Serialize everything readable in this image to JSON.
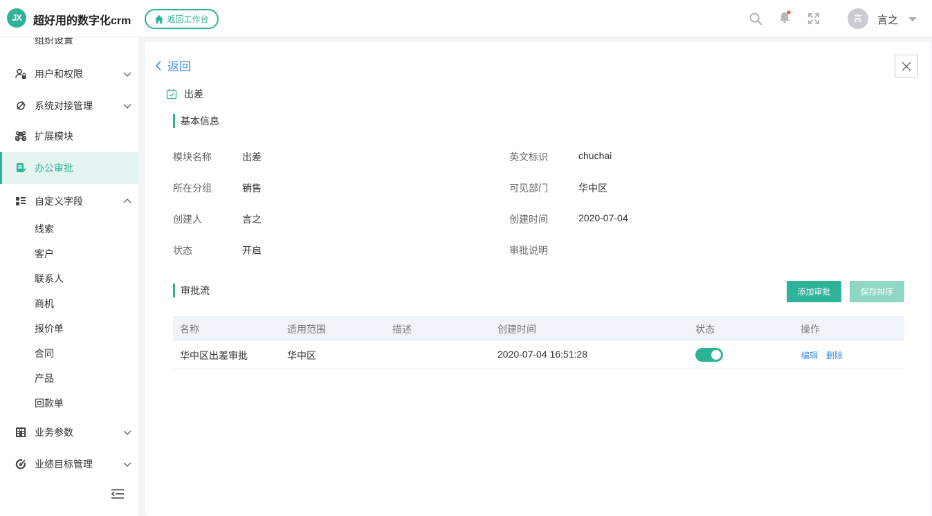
{
  "header": {
    "logo_text": "JX",
    "app_title": "超好用的数字化crm",
    "back_workbench": "返回工作台",
    "avatar_char": "言",
    "username": "言之",
    "brand_color": "#2eb398"
  },
  "sidebar": {
    "partial_label": "组织设置",
    "items": [
      {
        "label": "用户和权限",
        "icon": "user-lock-icon"
      },
      {
        "label": "系统对接管理",
        "icon": "plug-icon"
      },
      {
        "label": "扩展模块",
        "icon": "command-icon"
      },
      {
        "label": "办公审批",
        "icon": "approval-doc-icon"
      },
      {
        "label": "自定义字段",
        "icon": "list-grid-icon"
      },
      {
        "label": "业务参数",
        "icon": "grid-icon"
      },
      {
        "label": "业绩目标管理",
        "icon": "target-icon"
      }
    ],
    "sub_items": [
      "线索",
      "客户",
      "联系人",
      "商机",
      "报价单",
      "合同",
      "产品",
      "回款单"
    ]
  },
  "main": {
    "back_label": "返回",
    "module_title": "出差",
    "basic_section": "基本信息",
    "fields": {
      "name_label": "模块名称",
      "name_value": "出差",
      "en_label": "英文标识",
      "en_value": "chuchai",
      "group_label": "所在分组",
      "group_value": "销售",
      "dept_label": "可见部门",
      "dept_value": "华中区",
      "creator_label": "创建人",
      "creator_value": "言之",
      "created_label": "创建时间",
      "created_value": "2020-07-04",
      "status_label": "状态",
      "status_value": "开启",
      "desc_label": "审批说明"
    },
    "flow_section": "审批流",
    "add_button": "添加审批",
    "save_sort_button": "保存排序",
    "table": {
      "headers": [
        "名称",
        "适用范围",
        "描述",
        "创建时间",
        "状态",
        "操作"
      ],
      "rows": [
        {
          "name": "华中区出差审批",
          "scope": "华中区",
          "desc": "",
          "created": "2020-07-04 16:51:28",
          "enabled": true,
          "edit": "编辑",
          "delete": "删除"
        }
      ]
    }
  }
}
